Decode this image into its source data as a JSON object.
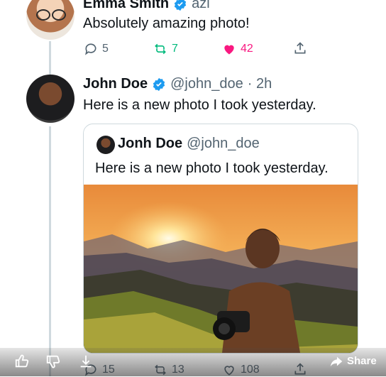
{
  "tweet1": {
    "name": "Emma Smith",
    "handle": "azi",
    "text": "Absolutely amazing photo!",
    "replies": "5",
    "retweets": "7",
    "likes": "42"
  },
  "tweet2": {
    "name": "John Doe",
    "handle": "@john_doe",
    "time": "· 2h",
    "text": "Here is a new photo I took yesterday.",
    "replies": "15",
    "retweets": "13",
    "likes": "108"
  },
  "quote": {
    "name": "Jonh Doe",
    "handle": "@john_doe",
    "text": "Here is a new photo I took yesterday."
  },
  "bottom_bar": {
    "share_label": "Share"
  },
  "colors": {
    "verified": "#1d9bf0",
    "retweet": "#00ba7c",
    "like": "#f91880",
    "muted": "#536471"
  }
}
